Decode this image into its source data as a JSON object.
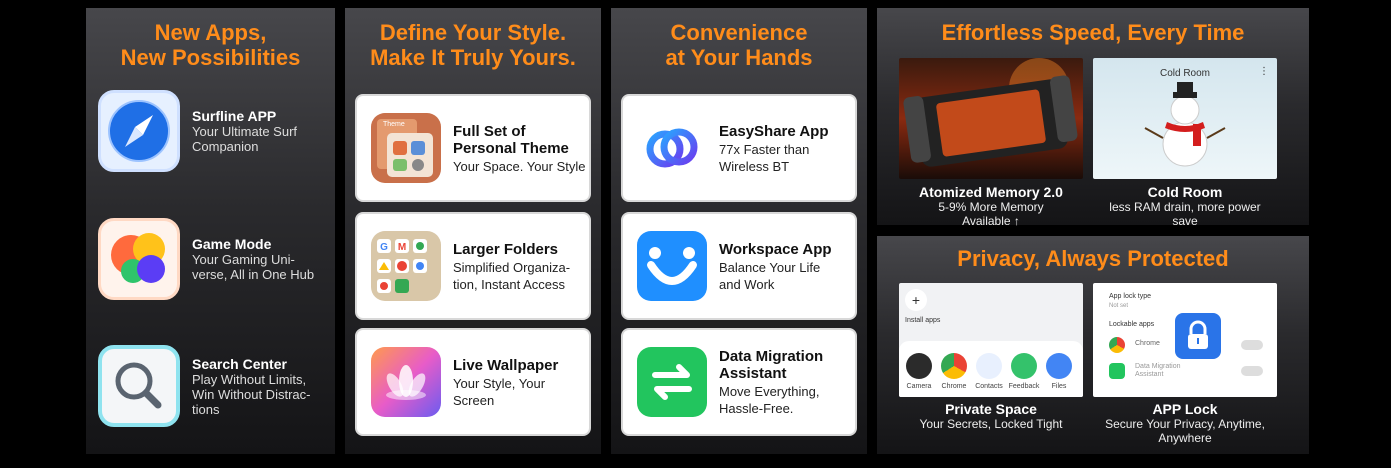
{
  "panel1": {
    "title_line1": "New Apps,",
    "title_line2": "New Possibilities",
    "apps": [
      {
        "name": "Surfline APP",
        "desc_line1": "Your Ultimate Surf",
        "desc_line2": "Companion",
        "icon": "compass-icon"
      },
      {
        "name": "Game Mode",
        "desc_line1": "Your Gaming Uni-",
        "desc_line2": "verse, All in One Hub",
        "icon": "game-bubbles-icon"
      },
      {
        "name": "Search Center",
        "desc_line1": "Play Without Limits,",
        "desc_line2": "Win Without Distrac-",
        "desc_line3": "tions",
        "icon": "magnifier-icon"
      }
    ]
  },
  "panel2": {
    "title_line1": "Define Your Style.",
    "title_line2": "Make It Truly Yours.",
    "cards": [
      {
        "title_line1": "Full Set of",
        "title_line2": "Personal Theme",
        "desc_line1": "Your Space. Your Style",
        "icon": "theme-icon",
        "icon_label": "Theme"
      },
      {
        "title_line1": "Larger Folders",
        "desc_line1": "Simplified Organiza-",
        "desc_line2": "tion, Instant Access",
        "icon": "folder-grid-icon"
      },
      {
        "title_line1": "Live Wallpaper",
        "desc_line1": "Your Style, Your",
        "desc_line2": "Screen",
        "icon": "lotus-icon"
      }
    ]
  },
  "panel3": {
    "title_line1": "Convenience",
    "title_line2": "at Your Hands",
    "cards": [
      {
        "title_line1": "EasyShare App",
        "desc_line1": "77x Faster than",
        "desc_line2": "Wireless BT",
        "icon": "linked-rings-icon"
      },
      {
        "title_line1": "Workspace App",
        "desc_line1": "Balance Your Life",
        "desc_line2": "and Work",
        "icon": "workspace-icon"
      },
      {
        "title_line1": "Data Migration",
        "title_line2": "Assistant",
        "desc_line1": "Move Everything,",
        "desc_line2": "Hassle-Free.",
        "icon": "transfer-arrows-icon"
      }
    ]
  },
  "panel4": {
    "title": "Effortless Speed, Every Time",
    "left": {
      "title": "Atomized Memory 2.0",
      "desc_line1": "5-9% More Memory",
      "desc_line2": "Available ↑"
    },
    "right": {
      "title": "Cold Room",
      "desc_line1": "less RAM drain, more power",
      "desc_line2": "save",
      "screen_label": "Cold Room"
    }
  },
  "panel5": {
    "title": "Privacy, Always Protected",
    "left": {
      "title": "Private Space",
      "desc": "Your Secrets, Locked Tight",
      "install_label": "Install apps",
      "apps": [
        "Camera",
        "Chrome",
        "Contacts",
        "Feedback",
        "Files"
      ]
    },
    "right": {
      "title": "APP Lock",
      "desc_line1": "Secure Your Privacy, Anytime,",
      "desc_line2": "Anywhere",
      "lock_type_label": "App lock type",
      "lock_type_value": "Not set",
      "lockable_label": "Lockable apps",
      "app1": "Chrome",
      "app2_line1": "Data Migration",
      "app2_line2": "Assistant"
    }
  },
  "colors": {
    "accent": "#ff8c1a",
    "panel_top": "#47474b",
    "panel_bottom": "#141416"
  }
}
